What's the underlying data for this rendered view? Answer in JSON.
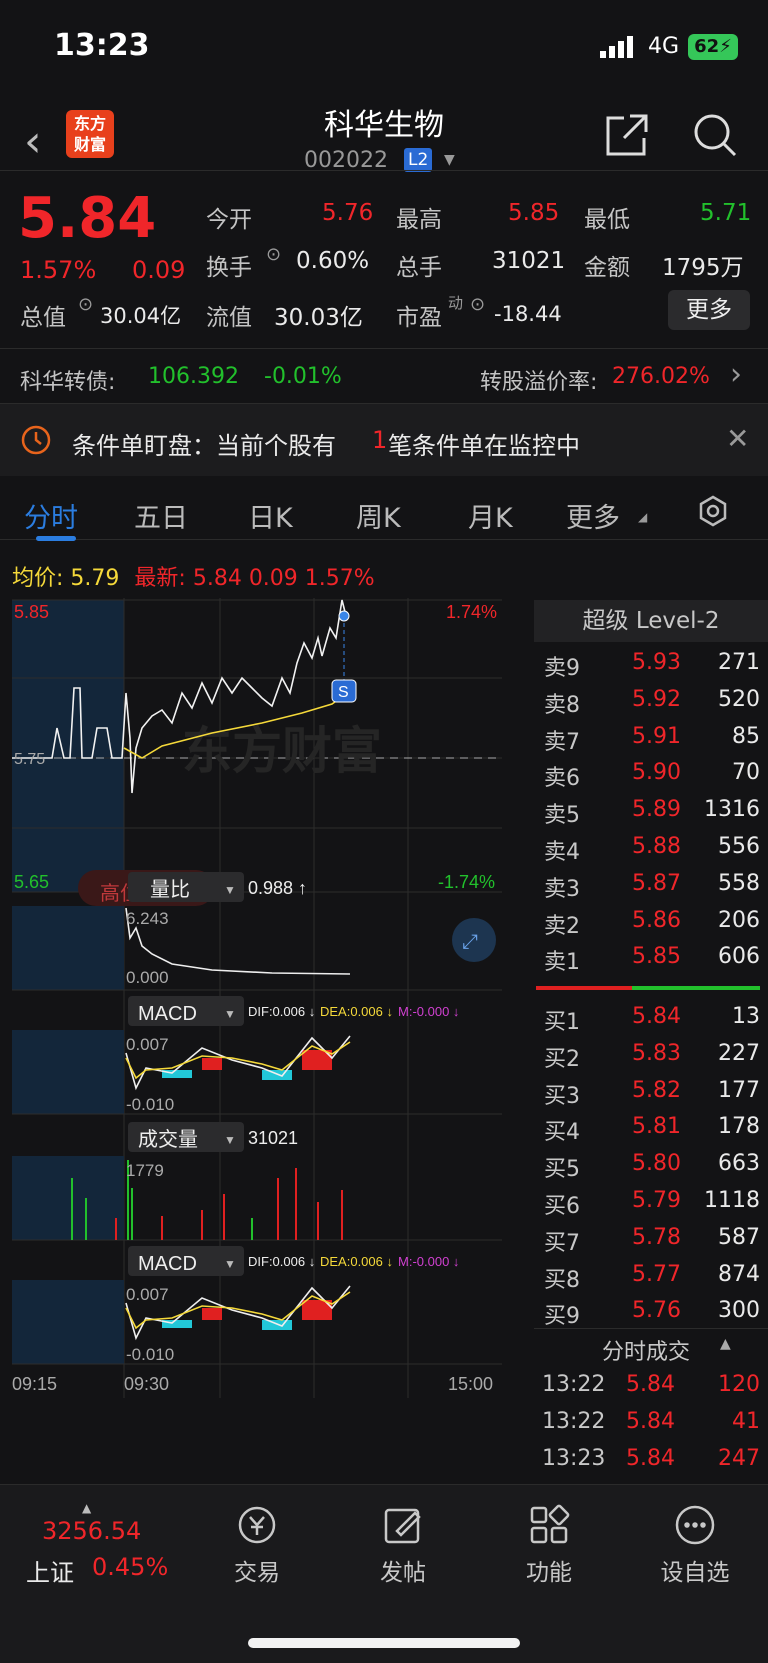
{
  "status_bar": {
    "time": "13:23",
    "network": "4G",
    "battery": "62"
  },
  "header": {
    "logo_line1": "东方",
    "logo_line2": "财富",
    "title": "科华生物",
    "code": "002022",
    "level_badge": "L2"
  },
  "quote": {
    "price": "5.84",
    "pct": "1.57%",
    "change": "0.09",
    "open_label": "今开",
    "open": "5.76",
    "high_label": "最高",
    "high": "5.85",
    "low_label": "最低",
    "low": "5.71",
    "turnover_label": "换手",
    "turnover": "0.60%",
    "volume_label": "总手",
    "volume": "31021",
    "amount_label": "金额",
    "amount": "1795万",
    "total_cap_label": "总值",
    "total_cap": "30.04亿",
    "float_cap_label": "流值",
    "float_cap": "30.03亿",
    "pe_label": "市盈",
    "pe_sup": "动",
    "pe": "-18.44",
    "more_button": "更多"
  },
  "bond": {
    "label": "科华转债:",
    "price": "106.392",
    "pct": "-0.01%",
    "premium_label": "转股溢价率:",
    "premium": "276.02%"
  },
  "alert": {
    "text_pre": "条件单盯盘：当前个股有",
    "count": "1",
    "text_post": "笔条件单在监控中"
  },
  "tabs": [
    "分时",
    "五日",
    "日K",
    "周K",
    "月K",
    "更多"
  ],
  "info": {
    "avg_label": "均价:",
    "avg": "5.79",
    "latest_label": "最新:",
    "latest": "5.84",
    "chg": "0.09",
    "pct": "1.57%"
  },
  "chart": {
    "price_top": "5.85",
    "price_mid": "5.75",
    "price_bottom": "5.65",
    "pct_top": "1.74%",
    "pct_bottom": "-1.74%",
    "watermark": "东方财富",
    "overlay_text": "高位以现",
    "s_marker": "S",
    "ratio_label": "量比",
    "ratio_value": "0.988 ↑",
    "ratio_max": "6.243",
    "ratio_min": "0.000",
    "macd_label": "MACD",
    "dif": "DIF:0.006 ↓",
    "dea": "DEA:0.006 ↓",
    "m": "M:-0.000 ↓",
    "macd_max": "0.007",
    "macd_min": "-0.010",
    "vol_label": "成交量",
    "vol_value": "31021",
    "vol_max": "1779",
    "time_start": "09:15",
    "time_open": "09:30",
    "time_end": "15:00"
  },
  "chart_data": {
    "type": "line",
    "title": "",
    "series": [
      {
        "name": "price",
        "values": [
          5.76,
          5.74,
          5.79,
          5.78,
          5.8,
          5.79,
          5.81,
          5.8,
          5.82,
          5.81,
          5.83,
          5.84
        ]
      },
      {
        "name": "avg",
        "values": [
          5.76,
          5.75,
          5.76,
          5.77,
          5.77,
          5.77,
          5.78,
          5.78,
          5.78,
          5.79,
          5.79,
          5.79
        ]
      }
    ],
    "ylim": [
      5.65,
      5.85
    ]
  },
  "level2": {
    "title": "超级 Level-2",
    "asks": [
      {
        "label": "卖9",
        "price": "5.93",
        "vol": "271"
      },
      {
        "label": "卖8",
        "price": "5.92",
        "vol": "520"
      },
      {
        "label": "卖7",
        "price": "5.91",
        "vol": "85"
      },
      {
        "label": "卖6",
        "price": "5.90",
        "vol": "70"
      },
      {
        "label": "卖5",
        "price": "5.89",
        "vol": "1316"
      },
      {
        "label": "卖4",
        "price": "5.88",
        "vol": "556"
      },
      {
        "label": "卖3",
        "price": "5.87",
        "vol": "558"
      },
      {
        "label": "卖2",
        "price": "5.86",
        "vol": "206"
      },
      {
        "label": "卖1",
        "price": "5.85",
        "vol": "606"
      }
    ],
    "bids": [
      {
        "label": "买1",
        "price": "5.84",
        "vol": "13"
      },
      {
        "label": "买2",
        "price": "5.83",
        "vol": "227"
      },
      {
        "label": "买3",
        "price": "5.82",
        "vol": "177"
      },
      {
        "label": "买4",
        "price": "5.81",
        "vol": "178"
      },
      {
        "label": "买5",
        "price": "5.80",
        "vol": "663"
      },
      {
        "label": "买6",
        "price": "5.79",
        "vol": "1118"
      },
      {
        "label": "买7",
        "price": "5.78",
        "vol": "587"
      },
      {
        "label": "买8",
        "price": "5.77",
        "vol": "874"
      },
      {
        "label": "买9",
        "price": "5.76",
        "vol": "300"
      }
    ],
    "trades_title": "分时成交",
    "trades": [
      {
        "time": "13:22",
        "price": "5.84",
        "vol": "120"
      },
      {
        "time": "13:22",
        "price": "5.84",
        "vol": "41"
      },
      {
        "time": "13:23",
        "price": "5.84",
        "vol": "247"
      }
    ]
  },
  "bottom": {
    "index_value": "3256.54",
    "index_name": "上证",
    "index_pct": "0.45%",
    "nav": [
      "交易",
      "发帖",
      "功能",
      "设自选"
    ]
  }
}
